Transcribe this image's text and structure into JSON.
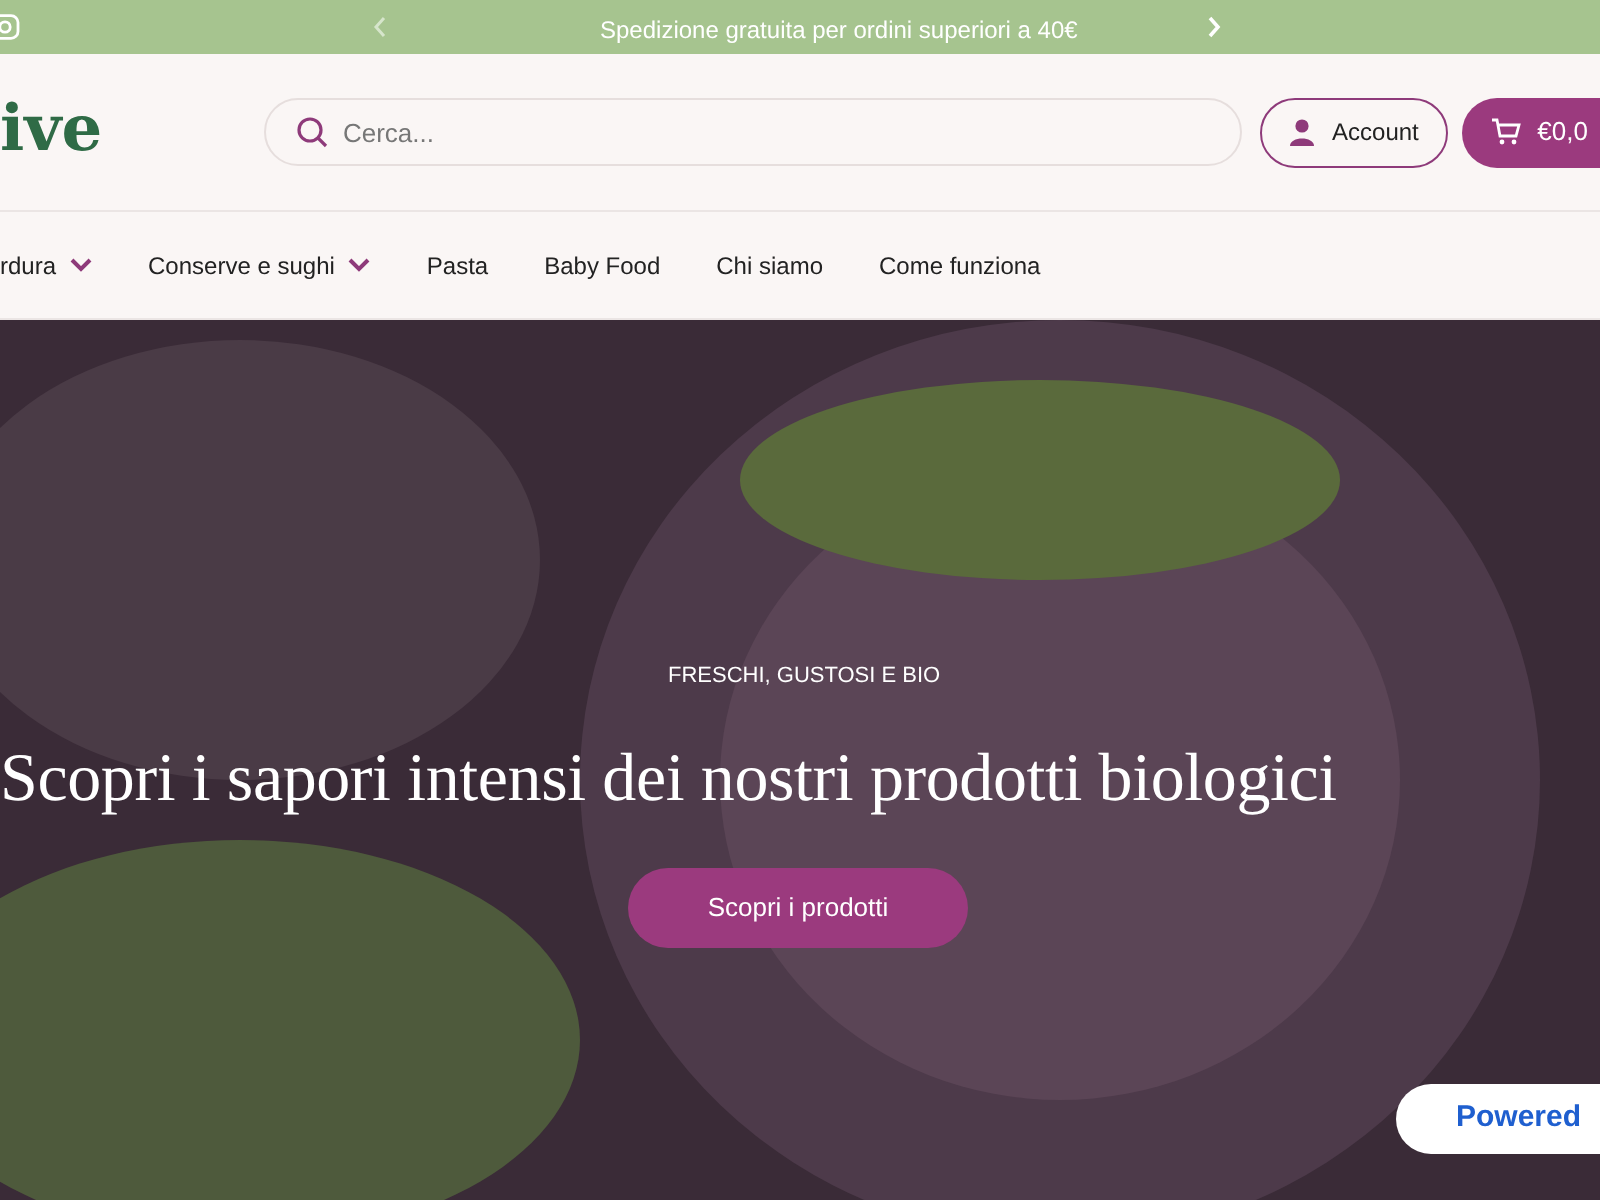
{
  "announcement_bar": {
    "text": "Spedizione gratuita per ordini superiori a 40€"
  },
  "header": {
    "logo": "ive",
    "search": {
      "placeholder": "Cerca..."
    },
    "account_button": "Account",
    "cart_button": "€0,0"
  },
  "nav": {
    "items": [
      {
        "label": "rdura",
        "has_dropdown": true
      },
      {
        "label": "Conserve e sughi",
        "has_dropdown": true
      },
      {
        "label": "Pasta",
        "has_dropdown": false
      },
      {
        "label": "Baby Food",
        "has_dropdown": false
      },
      {
        "label": "Chi siamo",
        "has_dropdown": false
      },
      {
        "label": "Come funziona",
        "has_dropdown": false
      }
    ]
  },
  "hero": {
    "eyebrow": "FRESCHI, GUSTOSI E BIO",
    "title": "Scopri i sapori intensi dei nostri prodotti biologici",
    "button": "Scopri i prodotti"
  },
  "badge": {
    "text": "Powered"
  }
}
